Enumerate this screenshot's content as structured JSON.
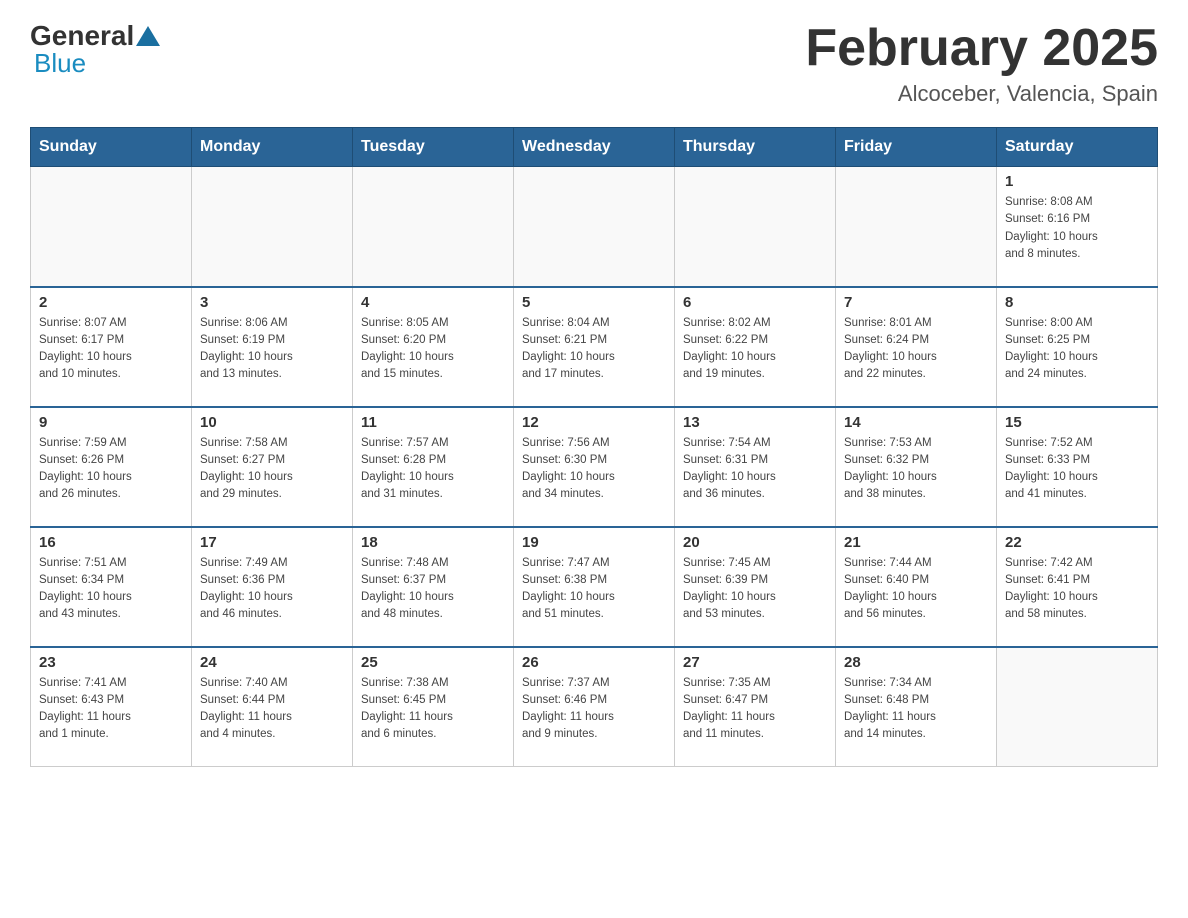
{
  "header": {
    "logo_general": "General",
    "logo_blue": "Blue",
    "title": "February 2025",
    "location": "Alcoceber, Valencia, Spain"
  },
  "weekdays": [
    "Sunday",
    "Monday",
    "Tuesday",
    "Wednesday",
    "Thursday",
    "Friday",
    "Saturday"
  ],
  "weeks": [
    [
      {
        "day": "",
        "info": ""
      },
      {
        "day": "",
        "info": ""
      },
      {
        "day": "",
        "info": ""
      },
      {
        "day": "",
        "info": ""
      },
      {
        "day": "",
        "info": ""
      },
      {
        "day": "",
        "info": ""
      },
      {
        "day": "1",
        "info": "Sunrise: 8:08 AM\nSunset: 6:16 PM\nDaylight: 10 hours\nand 8 minutes."
      }
    ],
    [
      {
        "day": "2",
        "info": "Sunrise: 8:07 AM\nSunset: 6:17 PM\nDaylight: 10 hours\nand 10 minutes."
      },
      {
        "day": "3",
        "info": "Sunrise: 8:06 AM\nSunset: 6:19 PM\nDaylight: 10 hours\nand 13 minutes."
      },
      {
        "day": "4",
        "info": "Sunrise: 8:05 AM\nSunset: 6:20 PM\nDaylight: 10 hours\nand 15 minutes."
      },
      {
        "day": "5",
        "info": "Sunrise: 8:04 AM\nSunset: 6:21 PM\nDaylight: 10 hours\nand 17 minutes."
      },
      {
        "day": "6",
        "info": "Sunrise: 8:02 AM\nSunset: 6:22 PM\nDaylight: 10 hours\nand 19 minutes."
      },
      {
        "day": "7",
        "info": "Sunrise: 8:01 AM\nSunset: 6:24 PM\nDaylight: 10 hours\nand 22 minutes."
      },
      {
        "day": "8",
        "info": "Sunrise: 8:00 AM\nSunset: 6:25 PM\nDaylight: 10 hours\nand 24 minutes."
      }
    ],
    [
      {
        "day": "9",
        "info": "Sunrise: 7:59 AM\nSunset: 6:26 PM\nDaylight: 10 hours\nand 26 minutes."
      },
      {
        "day": "10",
        "info": "Sunrise: 7:58 AM\nSunset: 6:27 PM\nDaylight: 10 hours\nand 29 minutes."
      },
      {
        "day": "11",
        "info": "Sunrise: 7:57 AM\nSunset: 6:28 PM\nDaylight: 10 hours\nand 31 minutes."
      },
      {
        "day": "12",
        "info": "Sunrise: 7:56 AM\nSunset: 6:30 PM\nDaylight: 10 hours\nand 34 minutes."
      },
      {
        "day": "13",
        "info": "Sunrise: 7:54 AM\nSunset: 6:31 PM\nDaylight: 10 hours\nand 36 minutes."
      },
      {
        "day": "14",
        "info": "Sunrise: 7:53 AM\nSunset: 6:32 PM\nDaylight: 10 hours\nand 38 minutes."
      },
      {
        "day": "15",
        "info": "Sunrise: 7:52 AM\nSunset: 6:33 PM\nDaylight: 10 hours\nand 41 minutes."
      }
    ],
    [
      {
        "day": "16",
        "info": "Sunrise: 7:51 AM\nSunset: 6:34 PM\nDaylight: 10 hours\nand 43 minutes."
      },
      {
        "day": "17",
        "info": "Sunrise: 7:49 AM\nSunset: 6:36 PM\nDaylight: 10 hours\nand 46 minutes."
      },
      {
        "day": "18",
        "info": "Sunrise: 7:48 AM\nSunset: 6:37 PM\nDaylight: 10 hours\nand 48 minutes."
      },
      {
        "day": "19",
        "info": "Sunrise: 7:47 AM\nSunset: 6:38 PM\nDaylight: 10 hours\nand 51 minutes."
      },
      {
        "day": "20",
        "info": "Sunrise: 7:45 AM\nSunset: 6:39 PM\nDaylight: 10 hours\nand 53 minutes."
      },
      {
        "day": "21",
        "info": "Sunrise: 7:44 AM\nSunset: 6:40 PM\nDaylight: 10 hours\nand 56 minutes."
      },
      {
        "day": "22",
        "info": "Sunrise: 7:42 AM\nSunset: 6:41 PM\nDaylight: 10 hours\nand 58 minutes."
      }
    ],
    [
      {
        "day": "23",
        "info": "Sunrise: 7:41 AM\nSunset: 6:43 PM\nDaylight: 11 hours\nand 1 minute."
      },
      {
        "day": "24",
        "info": "Sunrise: 7:40 AM\nSunset: 6:44 PM\nDaylight: 11 hours\nand 4 minutes."
      },
      {
        "day": "25",
        "info": "Sunrise: 7:38 AM\nSunset: 6:45 PM\nDaylight: 11 hours\nand 6 minutes."
      },
      {
        "day": "26",
        "info": "Sunrise: 7:37 AM\nSunset: 6:46 PM\nDaylight: 11 hours\nand 9 minutes."
      },
      {
        "day": "27",
        "info": "Sunrise: 7:35 AM\nSunset: 6:47 PM\nDaylight: 11 hours\nand 11 minutes."
      },
      {
        "day": "28",
        "info": "Sunrise: 7:34 AM\nSunset: 6:48 PM\nDaylight: 11 hours\nand 14 minutes."
      },
      {
        "day": "",
        "info": ""
      }
    ]
  ]
}
